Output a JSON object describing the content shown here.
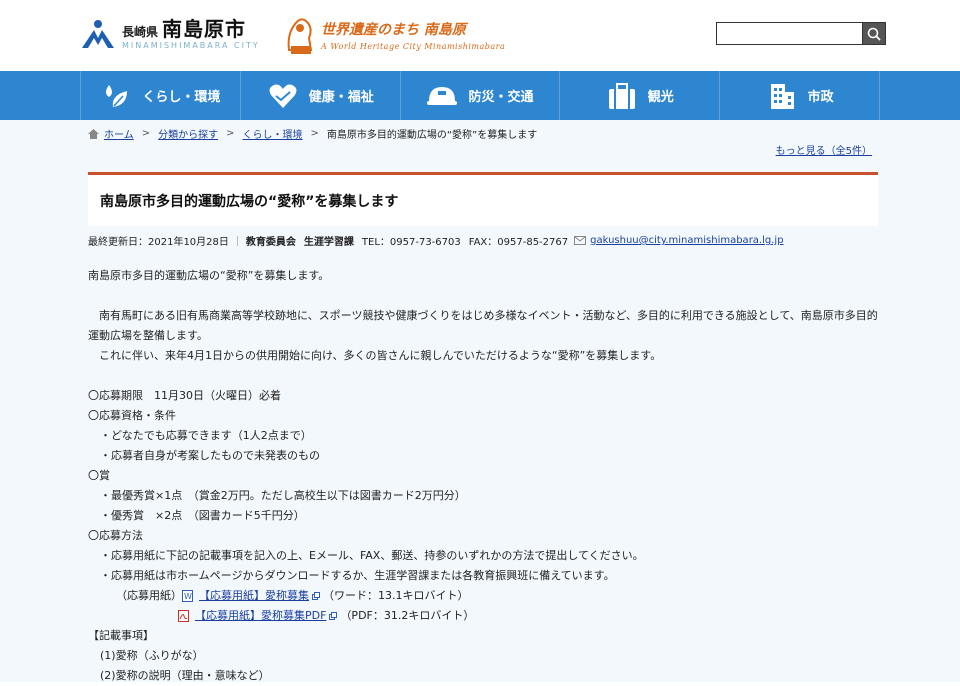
{
  "header": {
    "pref": "長崎県",
    "city": "南島原市",
    "city_roman": "MINAMISHIMABARA CITY",
    "heritage_title": "世界遺産のまち 南島原",
    "heritage_sub": "A World  Heritage City Minamishimabara",
    "search_placeholder": ""
  },
  "nav": [
    {
      "label": "くらし・環境",
      "icon": "leaf-drop-icon"
    },
    {
      "label": "健康・福祉",
      "icon": "heart-hands-icon"
    },
    {
      "label": "防災・交通",
      "icon": "helmet-icon"
    },
    {
      "label": "観光",
      "icon": "suitcase-icon"
    },
    {
      "label": "市政",
      "icon": "building-icon"
    }
  ],
  "breadcrumb": {
    "home": "ホーム",
    "b1": "分類から探す",
    "b2": "くらし・環境",
    "current": "南島原市多目的運動広場の“愛称”を募集します",
    "sep": ">"
  },
  "more_link": "もっと見る（全5件）",
  "page_title": "南島原市多目的運動広場の“愛称”を募集します",
  "meta": {
    "updated": "最終更新日：2021年10月28日",
    "dept": "教育委員会",
    "section": "生涯学習課",
    "tel": "TEL：0957-73-6703",
    "fax": "FAX：0957-85-2767",
    "email": "gakushuu@city.minamishimabara.lg.jp"
  },
  "content": {
    "intro": "南島原市多目的運動広場の“愛称”を募集します。",
    "p1": "　南有馬町にある旧有馬商業高等学校跡地に、スポーツ競技や健康づくりをはじめ多様なイベント・活動など、多目的に利用できる施設として、南島原市多目的運動広場を整備します。",
    "p2": "　これに伴い、来年4月1日からの供用開始に向け、多くの皆さんに親しんでいただけるような“愛称”を募集します。",
    "period": "〇応募期限　11月30日（火曜日）必着",
    "eligibility": "〇応募資格・条件",
    "elig1": "・どなたでも応募できます（1人2点まで）",
    "elig2": "・応募者自身が考案したもので未発表のもの",
    "prize": "〇賞",
    "prize1": "・最優秀賞×1点　（賞金2万円。ただし高校生以下は図書カード2万円分）",
    "prize2": "・優秀賞　×2点　（図書カード5千円分）",
    "method": "〇応募方法",
    "method1": "・応募用紙に下記の記載事項を記入の上、Eメール、FAX、郵送、持参のいずれかの方法で提出してください。",
    "method2": "・応募用紙は市ホームページからダウンロードするか、生涯学習課または各教育振興班に備えています。",
    "form_label": "（応募用紙）",
    "file1_link": "【応募用紙】愛称募集",
    "file1_info": "（ワード：13.1キロバイト）",
    "file2_link": "【応募用紙】愛称募集PDF",
    "file2_info": "（PDF：31.2キロバイト）",
    "items_heading": "【記載事項】",
    "item1": "(1)愛称（ふりがな）",
    "item2": "(2)愛称の説明（理由・意味など）"
  },
  "colors": {
    "nav_bg": "#2e86d1",
    "title_border": "#c9502c",
    "heritage": "#d96a1a",
    "link": "#1a3fa0"
  }
}
